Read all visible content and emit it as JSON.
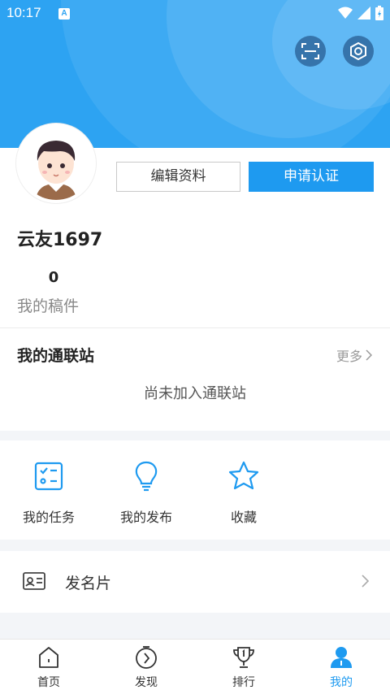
{
  "status_bar": {
    "time": "10:17",
    "notification_badge": "A"
  },
  "header": {
    "scan_icon": "scan-icon",
    "settings_icon": "settings-icon"
  },
  "profile": {
    "edit_label": "编辑资料",
    "auth_label": "申请认证",
    "username": "云友1697",
    "manuscript_count": "0",
    "manuscript_label": "我的稿件"
  },
  "station": {
    "title": "我的通联站",
    "more_label": "更多",
    "empty_text": "尚未加入通联站"
  },
  "features": [
    {
      "label": "我的任务",
      "icon": "task-list-icon"
    },
    {
      "label": "我的发布",
      "icon": "lightbulb-icon"
    },
    {
      "label": "收藏",
      "icon": "star-icon"
    }
  ],
  "card_row": {
    "label": "发名片",
    "icon": "id-card-icon"
  },
  "tabs": [
    {
      "label": "首页",
      "icon": "home-icon"
    },
    {
      "label": "发现",
      "icon": "compass-icon"
    },
    {
      "label": "排行",
      "icon": "trophy-icon"
    },
    {
      "label": "我的",
      "icon": "person-icon"
    }
  ],
  "colors": {
    "brand": "#2da3f2",
    "accent": "#1e9af0",
    "text": "#222222",
    "muted": "#888888"
  }
}
